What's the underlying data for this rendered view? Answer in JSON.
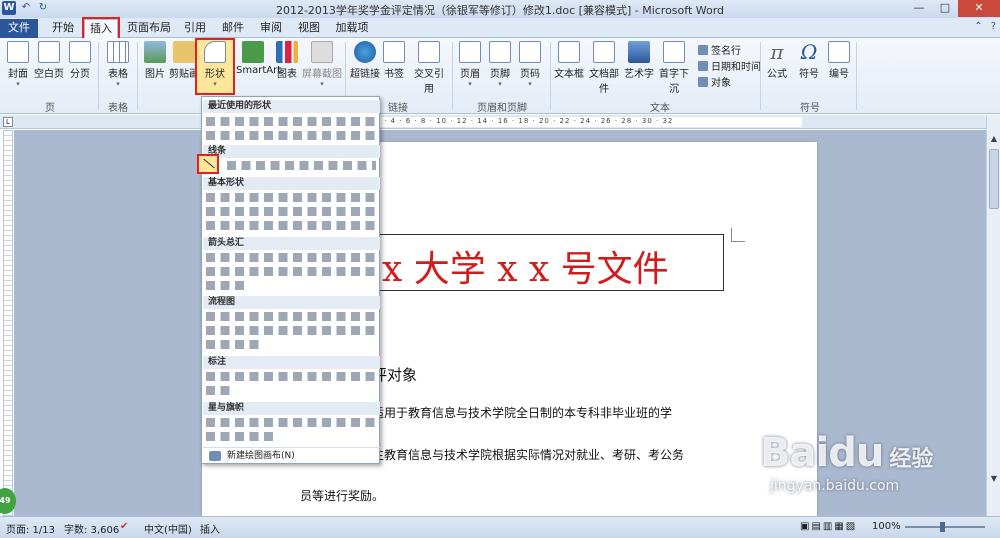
{
  "window": {
    "title": "2012-2013学年奖学金评定情况（徐银军等修订）修改1.doc [兼容模式] - Microsoft Word",
    "controls": [
      "—",
      "□",
      "✕"
    ]
  },
  "qat": [
    "W",
    "↶",
    "↻"
  ],
  "tabs": [
    "文件",
    "开始",
    "插入",
    "页面布局",
    "引用",
    "邮件",
    "审阅",
    "视图",
    "加载项"
  ],
  "ribbon": {
    "page_group": {
      "label": "页",
      "buttons": [
        "封面",
        "空白页",
        "分页"
      ]
    },
    "table_group": {
      "label": "表格",
      "buttons": [
        "表格"
      ]
    },
    "illus_group": {
      "buttons": [
        "图片",
        "剪贴画",
        "形状",
        "SmartArt",
        "图表",
        "屏幕截图"
      ]
    },
    "links_group": {
      "label": "链接",
      "buttons": [
        "超链接",
        "书签",
        "交叉引用"
      ]
    },
    "hf_group": {
      "label": "页眉和页脚",
      "buttons": [
        "页眉",
        "页脚",
        "页码"
      ]
    },
    "text_group": {
      "label": "文本",
      "buttons": [
        "文本框",
        "文档部件",
        "艺术字",
        "首字下沉"
      ],
      "small": [
        "签名行",
        "日期和时间",
        "对象"
      ]
    },
    "symbol_group": {
      "label": "符号",
      "buttons": [
        "公式",
        "符号",
        "编号"
      ]
    }
  },
  "ruler": "8 · 6 · 4 · 2 · | · 2 · 4 · 6 · 8 · 10 · 12 · 14 · 16 · 18 · 20 · 22 · 24 · 26 · 28 · 30 · 32",
  "shapes_panel": {
    "sections": [
      "最近使用的形状",
      "线条",
      "基本形状",
      "箭头总汇",
      "流程图",
      "标注",
      "星与旗帜"
    ],
    "new_canvas": "新建绘图画布(N)"
  },
  "document": {
    "header_text": "x 大学 x  x 号文件",
    "heading_tail": "评对象",
    "para1": "适用于教育信息与技术学院全日制的本专科非毕业班的学",
    "para2": "生教育信息与技术学院根据实际情况对就业、考研、考公务",
    "para3": "员等进行奖励。"
  },
  "status": {
    "page": "页面: 1/13",
    "words": "字数: 3,606",
    "lang": "中文(中国)",
    "mode": "插入",
    "zoom": "100%",
    "badge": "49"
  },
  "watermark": {
    "brand": "Baidu",
    "cn": "经验",
    "url": "jingyan.baidu.com"
  },
  "colors": {
    "accent": "#2b579a",
    "highlight": "#dd2222",
    "doc_red": "#d21c1c"
  }
}
